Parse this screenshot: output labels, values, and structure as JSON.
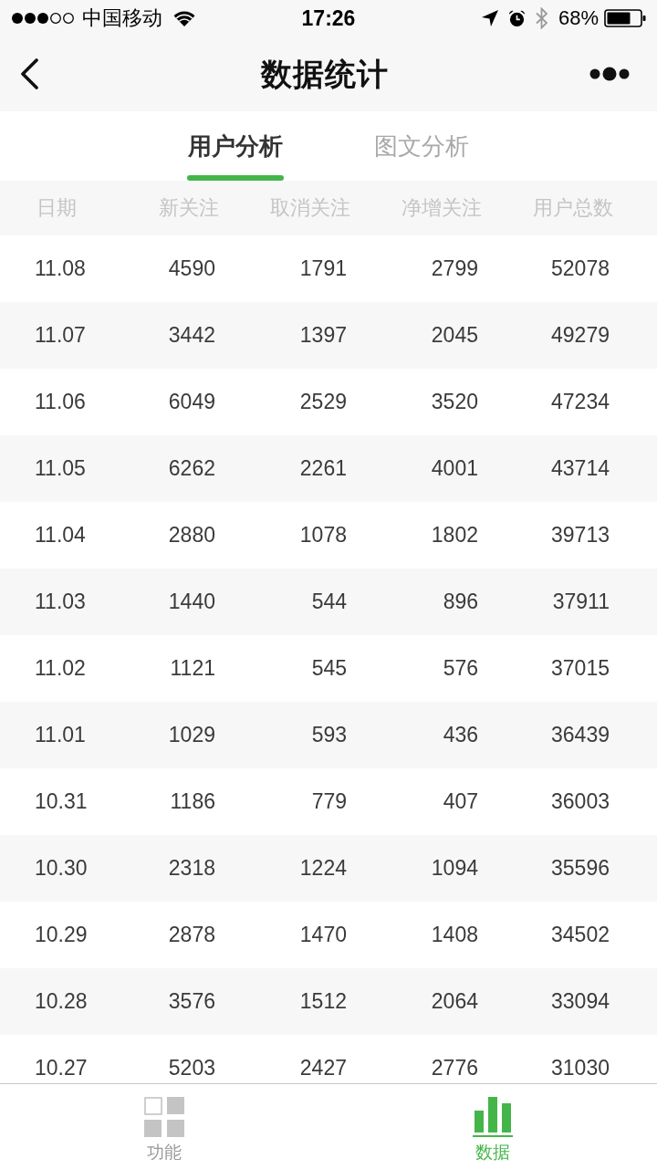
{
  "status_bar": {
    "carrier": "中国移动",
    "time": "17:26",
    "battery": "68%"
  },
  "nav_bar": {
    "title": "数据统计"
  },
  "tabs": [
    {
      "label": "用户分析",
      "selected": true
    },
    {
      "label": "图文分析",
      "selected": false
    }
  ],
  "table": {
    "columns": [
      "日期",
      "新关注",
      "取消关注",
      "净增关注",
      "用户总数"
    ],
    "rows": [
      [
        "11.08",
        "4590",
        "1791",
        "2799",
        "52078"
      ],
      [
        "11.07",
        "3442",
        "1397",
        "2045",
        "49279"
      ],
      [
        "11.06",
        "6049",
        "2529",
        "3520",
        "47234"
      ],
      [
        "11.05",
        "6262",
        "2261",
        "4001",
        "43714"
      ],
      [
        "11.04",
        "2880",
        "1078",
        "1802",
        "39713"
      ],
      [
        "11.03",
        "1440",
        "544",
        "896",
        "37911"
      ],
      [
        "11.02",
        "1121",
        "545",
        "576",
        "37015"
      ],
      [
        "11.01",
        "1029",
        "593",
        "436",
        "36439"
      ],
      [
        "10.31",
        "1186",
        "779",
        "407",
        "36003"
      ],
      [
        "10.30",
        "2318",
        "1224",
        "1094",
        "35596"
      ],
      [
        "10.29",
        "2878",
        "1470",
        "1408",
        "34502"
      ],
      [
        "10.28",
        "3576",
        "1512",
        "2064",
        "33094"
      ],
      [
        "10.27",
        "5203",
        "2427",
        "2776",
        "31030"
      ]
    ]
  },
  "bottom_tabs": [
    {
      "label": "功能",
      "kind": "grid",
      "selected": false
    },
    {
      "label": "数据",
      "kind": "chart",
      "selected": true
    }
  ]
}
